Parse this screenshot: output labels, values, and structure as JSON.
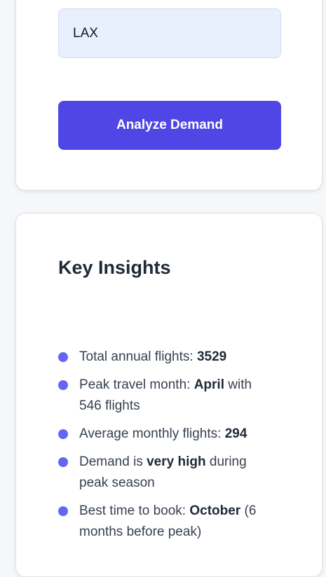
{
  "search": {
    "airport_value": "LAX"
  },
  "actions": {
    "analyze_label": "Analyze Demand"
  },
  "insights": {
    "title": "Key Insights",
    "items": [
      {
        "prefix": "Total annual flights: ",
        "bold": "3529",
        "suffix": ""
      },
      {
        "prefix": "Peak travel month: ",
        "bold": "April",
        "suffix": " with 546 flights"
      },
      {
        "prefix": "Average monthly flights: ",
        "bold": "294",
        "suffix": ""
      },
      {
        "prefix": "Demand is ",
        "bold": "very high",
        "suffix": " during peak season"
      },
      {
        "prefix": "Best time to book: ",
        "bold": "October",
        "suffix": " (6 months before peak)"
      }
    ]
  },
  "colors": {
    "accent": "#4f46e5",
    "bullet": "#6366f1",
    "input_bg": "#e8effd"
  }
}
